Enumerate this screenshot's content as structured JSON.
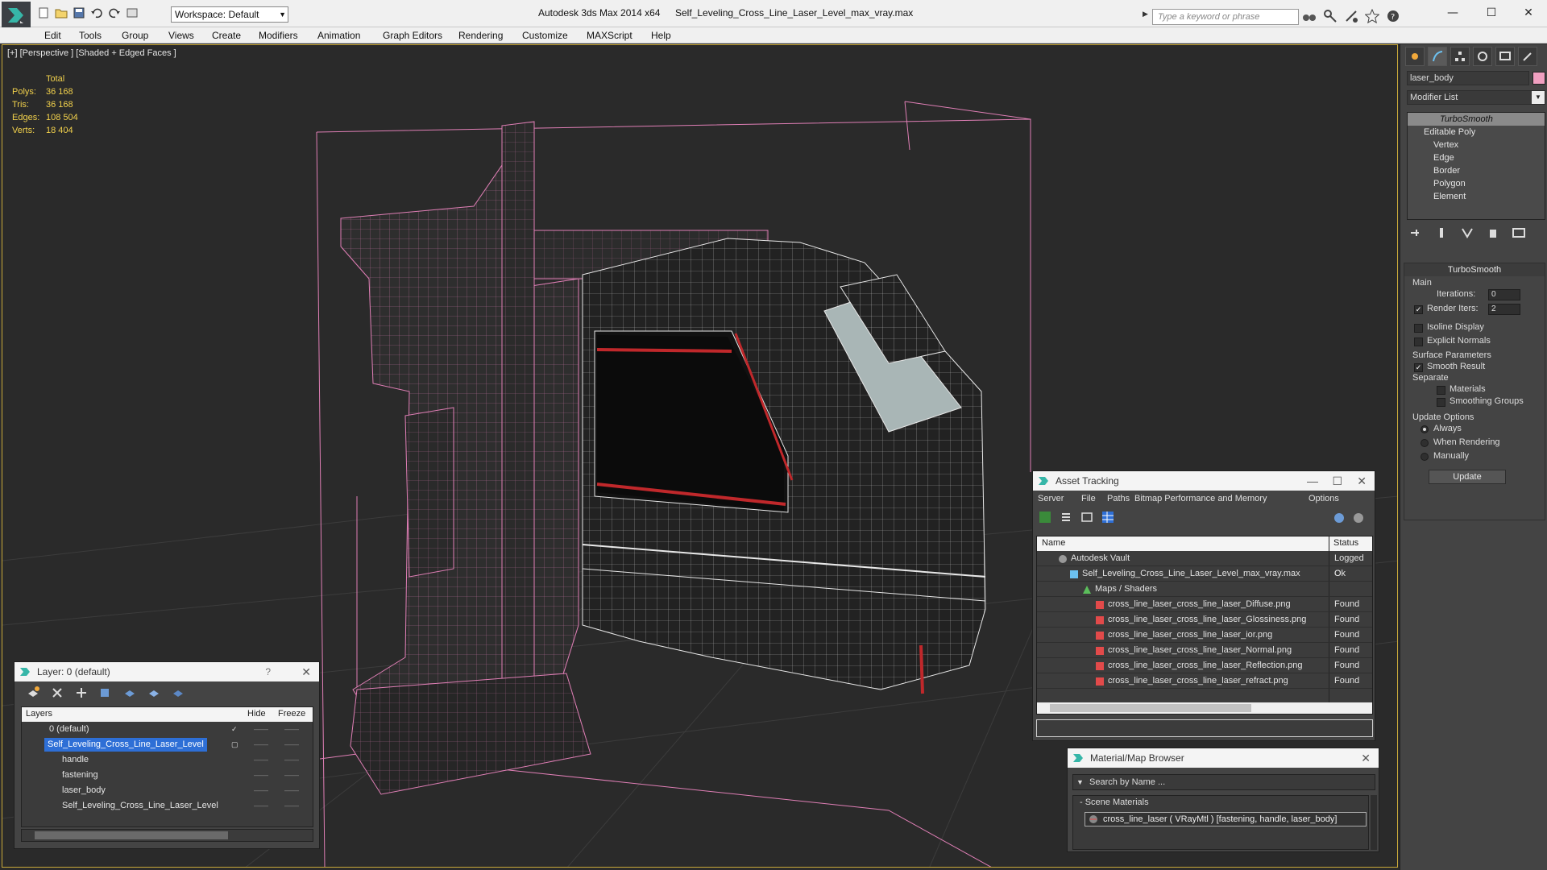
{
  "titlebar": {
    "workspace": "Workspace: Default",
    "app_title": "Autodesk 3ds Max  2014 x64",
    "file_title": "Self_Leveling_Cross_Line_Laser_Level_max_vray.max",
    "search_placeholder": "Type a keyword or phrase"
  },
  "menu": [
    "Edit",
    "Tools",
    "Group",
    "Views",
    "Create",
    "Modifiers",
    "Animation",
    "Graph Editors",
    "Rendering",
    "Customize",
    "MAXScript",
    "Help"
  ],
  "viewport": {
    "label": "[+] [Perspective ] [Shaded + Edged Faces ]",
    "stats": {
      "header": "Total",
      "rows": [
        {
          "key": "Polys:",
          "value": "36 168"
        },
        {
          "key": "Tris:",
          "value": "36 168"
        },
        {
          "key": "Edges:",
          "value": "108 504"
        },
        {
          "key": "Verts:",
          "value": "18 404"
        }
      ]
    }
  },
  "command_panel": {
    "object_name": "laser_body",
    "modifier_list": "Modifier List",
    "stack": {
      "modifier": "TurboSmooth",
      "base": "Editable Poly",
      "subobjects": [
        "Vertex",
        "Edge",
        "Border",
        "Polygon",
        "Element"
      ]
    },
    "turbosmooth": {
      "title": "TurboSmooth",
      "main": "Main",
      "iterations_label": "Iterations:",
      "iterations": "0",
      "render_iters_label": "Render Iters:",
      "render_iters": "2",
      "isoline": "Isoline Display",
      "explicit_normals": "Explicit Normals",
      "surface_params": "Surface Parameters",
      "smooth_result": "Smooth Result",
      "separate": "Separate",
      "materials": "Materials",
      "smoothing_groups": "Smoothing Groups",
      "update_options": "Update Options",
      "always": "Always",
      "when_rendering": "When Rendering",
      "manually": "Manually",
      "update": "Update"
    }
  },
  "layer_window": {
    "title": "Layer: 0 (default)",
    "help": "?",
    "columns": {
      "layers": "Layers",
      "hide": "Hide",
      "freeze": "Freeze"
    },
    "rows": [
      {
        "name": "0 (default)"
      },
      {
        "name": "Self_Leveling_Cross_Line_Laser_Level"
      },
      {
        "name": "handle"
      },
      {
        "name": "fastening"
      },
      {
        "name": "laser_body"
      },
      {
        "name": "Self_Leveling_Cross_Line_Laser_Level"
      }
    ]
  },
  "asset_window": {
    "title": "Asset Tracking",
    "menu": [
      "Server",
      "File",
      "Paths",
      "Bitmap Performance and Memory",
      "Options"
    ],
    "columns": {
      "name": "Name",
      "status": "Status"
    },
    "rows": [
      {
        "name": "Autodesk Vault",
        "status": "Logged O"
      },
      {
        "name": "Self_Leveling_Cross_Line_Laser_Level_max_vray.max",
        "status": "Ok"
      },
      {
        "name": "Maps / Shaders",
        "status": ""
      },
      {
        "name": "cross_line_laser_cross_line_laser_Diffuse.png",
        "status": "Found"
      },
      {
        "name": "cross_line_laser_cross_line_laser_Glossiness.png",
        "status": "Found"
      },
      {
        "name": "cross_line_laser_cross_line_laser_ior.png",
        "status": "Found"
      },
      {
        "name": "cross_line_laser_cross_line_laser_Normal.png",
        "status": "Found"
      },
      {
        "name": "cross_line_laser_cross_line_laser_Reflection.png",
        "status": "Found"
      },
      {
        "name": "cross_line_laser_cross_line_laser_refract.png",
        "status": "Found"
      }
    ]
  },
  "material_window": {
    "title": "Material/Map Browser",
    "search_placeholder": "Search by Name ...",
    "group": "- Scene Materials",
    "item": "cross_line_laser  ( VRayMtl ) [fastening, handle, laser_body]"
  },
  "colors": {
    "accent": "#2e6fd6",
    "stats": "#f2d14c",
    "wire": "#e07fb6",
    "viewport_border": "#c9a93a"
  }
}
